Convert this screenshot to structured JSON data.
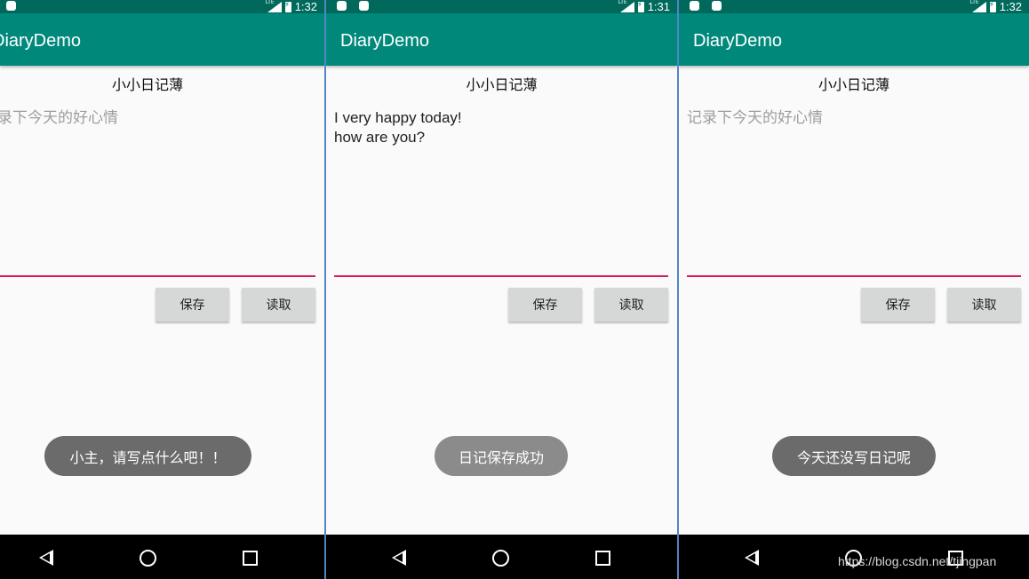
{
  "screens": [
    {
      "status_time": "1:32",
      "app_title": "DiaryDemo",
      "diary_title": "小小日记薄",
      "editor": {
        "value_lines": [],
        "placeholder": "记录下今天的好心情"
      },
      "buttons": {
        "save": "保存",
        "read": "读取"
      },
      "toast": "小主，请写点什么吧！！"
    },
    {
      "status_time": "1:31",
      "app_title": "DiaryDemo",
      "diary_title": "小小日记薄",
      "editor": {
        "value_lines": [
          "I very happy today!",
          "how are you?"
        ],
        "placeholder": "记录下今天的好心情"
      },
      "buttons": {
        "save": "保存",
        "read": "读取"
      },
      "toast": "日记保存成功"
    },
    {
      "status_time": "1:32",
      "app_title": "DiaryDemo",
      "diary_title": "小小日记薄",
      "editor": {
        "value_lines": [],
        "placeholder": "记录下今天的好心情"
      },
      "buttons": {
        "save": "保存",
        "read": "读取"
      },
      "toast": "今天还没写日记呢"
    }
  ],
  "icons": {
    "notification": "android-notification-icon",
    "signal": "lte-signal-icon",
    "battery": "battery-charging-icon",
    "back": "nav-back-icon",
    "home": "nav-home-icon",
    "recents": "nav-recents-icon"
  },
  "colors": {
    "status_bar": "#00695c",
    "app_bar": "#00897b",
    "edit_underline": "#d81b60",
    "button_bg": "#d6d7d7",
    "toast_bg": "#6b6b6b",
    "toast_bg_light": "#8b8b8b",
    "nav_bar": "#000000",
    "screen_divider": "#4f86c6"
  },
  "watermark": "https://blog.csdn.net/tjingpan"
}
